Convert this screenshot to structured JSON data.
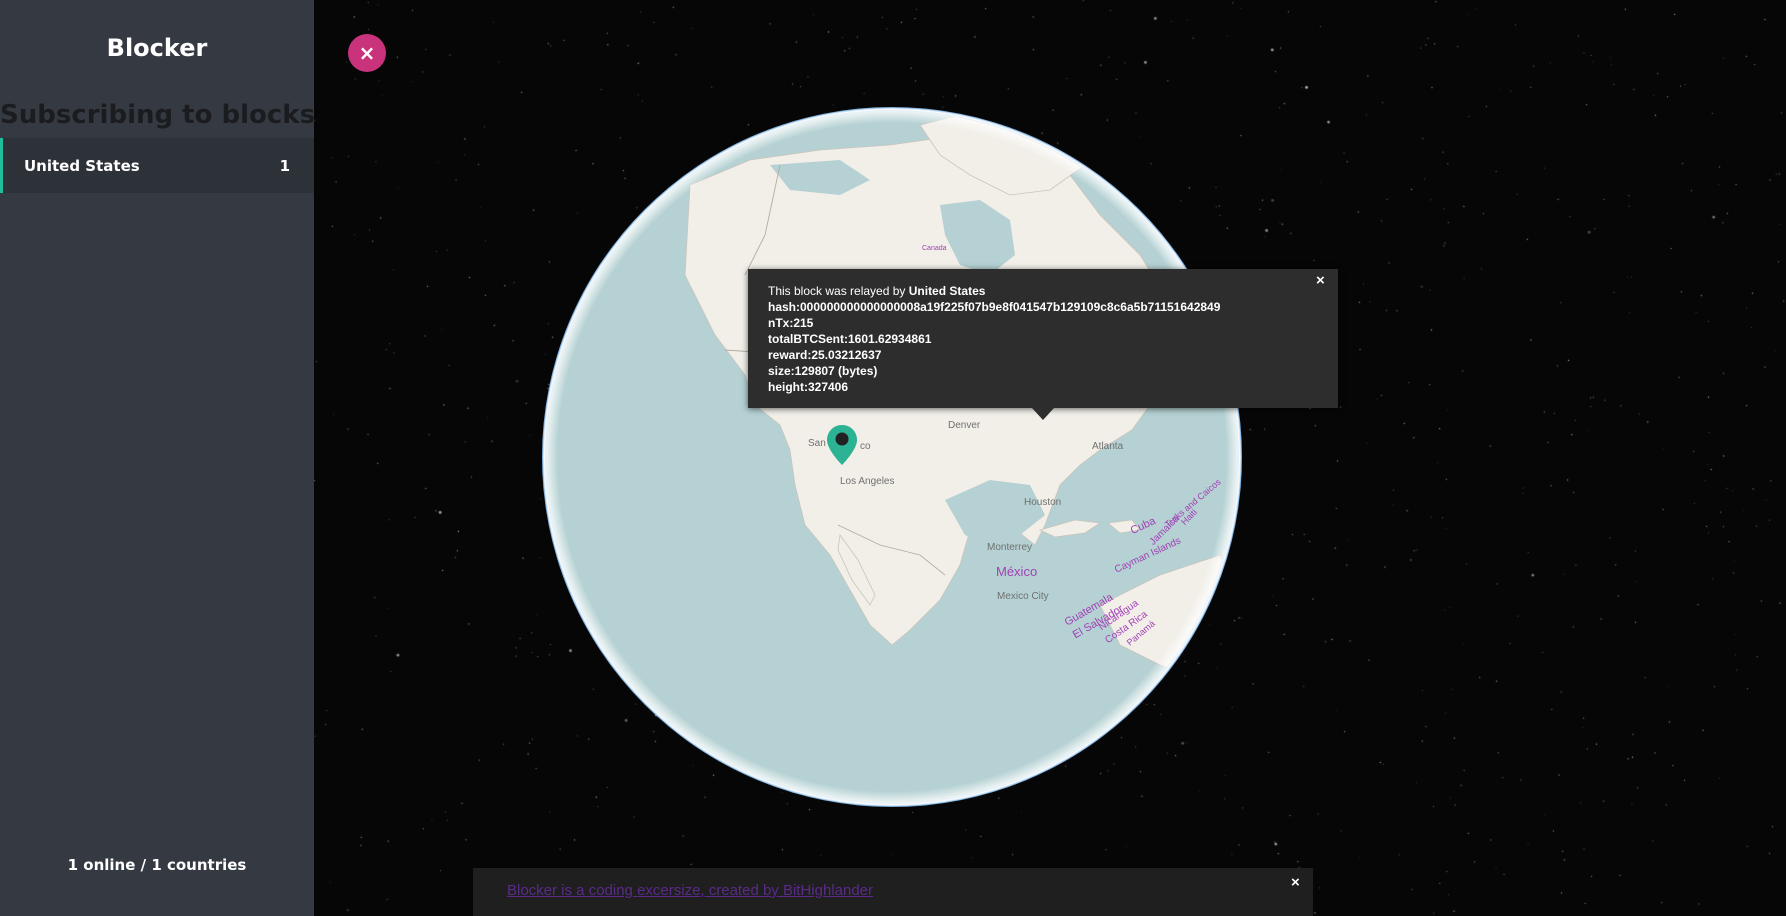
{
  "sidebar": {
    "title": "Blocker",
    "section_title": "Subscribing to blocks",
    "countries": [
      {
        "name": "United States",
        "count": "1"
      }
    ],
    "footer": "1 online / 1 countries"
  },
  "close_button": {
    "icon": "close-icon",
    "glyph": "×",
    "color": "#c8337b"
  },
  "map": {
    "city_labels": {
      "san_francisco": "San",
      "san_francisco_end": "co",
      "los_angeles": "Los Angeles",
      "denver": "Denver",
      "houston": "Houston",
      "atlanta": "Atlanta",
      "monterrey": "Monterrey",
      "mexico_city": "Mexico City",
      "canada": "Canada"
    },
    "country_labels": {
      "mexico": "México",
      "cuba": "Cuba",
      "cayman": "Cayman Islands",
      "jamaica": "Jamaica",
      "haiti": "Haiti",
      "turks": "Turks and Caicos",
      "guatemala": "Guatemala",
      "el_salvador": "El Salvador",
      "nicaragua": "Nicaragua",
      "costa_rica": "Costa Rica",
      "panama": "Panamá"
    },
    "ocean_color": "#b5d1d3",
    "land_color": "#f2efe9",
    "marker_color": "#2bb394"
  },
  "popup": {
    "relay_prefix": "This block was relayed by ",
    "relay_country": "United States",
    "hash": "hash:000000000000000008a19f225f07b9e8f041547b129109c8c6a5b71151642849",
    "ntx": "nTx:215",
    "total_btc_sent": "totalBTCSent:1601.62934861",
    "reward": "reward:25.03212637",
    "size": "size:129807 (bytes)",
    "height": "height:327406",
    "close_glyph": "×"
  },
  "banner": {
    "link_text": "Blocker is a coding excersize, created by BitHighlander",
    "close_glyph": "×"
  }
}
